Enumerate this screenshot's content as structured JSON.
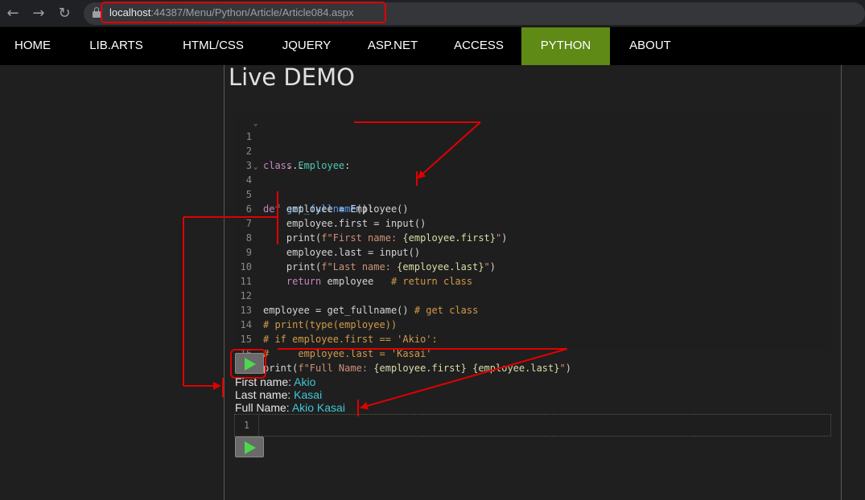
{
  "browser": {
    "url_host": "localhost",
    "url_rest": ":44387/Menu/Python/Article/Article084.aspx"
  },
  "nav": {
    "items": [
      {
        "label": "HOME"
      },
      {
        "label": "LIB.ARTS"
      },
      {
        "label": "HTML/CSS"
      },
      {
        "label": "JQUERY"
      },
      {
        "label": "ASP.NET"
      },
      {
        "label": "ACCESS"
      },
      {
        "label": "PYTHON"
      },
      {
        "label": "ABOUT"
      }
    ],
    "active": "PYTHON",
    "active_color": "#5f8a16"
  },
  "page": {
    "title": "Live DEMO"
  },
  "editor": {
    "line_numbers": [
      "1",
      "2",
      "3",
      "4",
      "5",
      "6",
      "7",
      "8",
      "9",
      "10",
      "11",
      "12",
      "13",
      "14",
      "15",
      "16"
    ],
    "lines": [
      "class Employee:",
      "    ...",
      "",
      "def get_fullname():",
      "    employee = Employee()",
      "    employee.first = input()",
      "    print(f\"First name: {employee.first}\")",
      "    employee.last = input()",
      "    print(f\"Last name: {employee.last}\")",
      "    return employee   # return class",
      "",
      "employee = get_fullname() # get class",
      "# print(type(employee))",
      "# if employee.first == 'Akio':",
      "#     employee.last = 'Kasai'",
      "print(f\"Full Name: {employee.first} {employee.last}\")"
    ]
  },
  "output": {
    "line1_label": "First name: ",
    "line1_value": "Akio",
    "line2_label": "Last name: ",
    "line2_value": "Kasai",
    "line3_label": "Full Name: ",
    "line3_value": "Akio Kasai"
  },
  "editor2": {
    "line_number": "1"
  },
  "icons": {
    "back": "arrow-left-icon",
    "forward": "arrow-right-icon",
    "reload": "reload-icon",
    "lock": "lock-icon",
    "run": "play-icon"
  }
}
